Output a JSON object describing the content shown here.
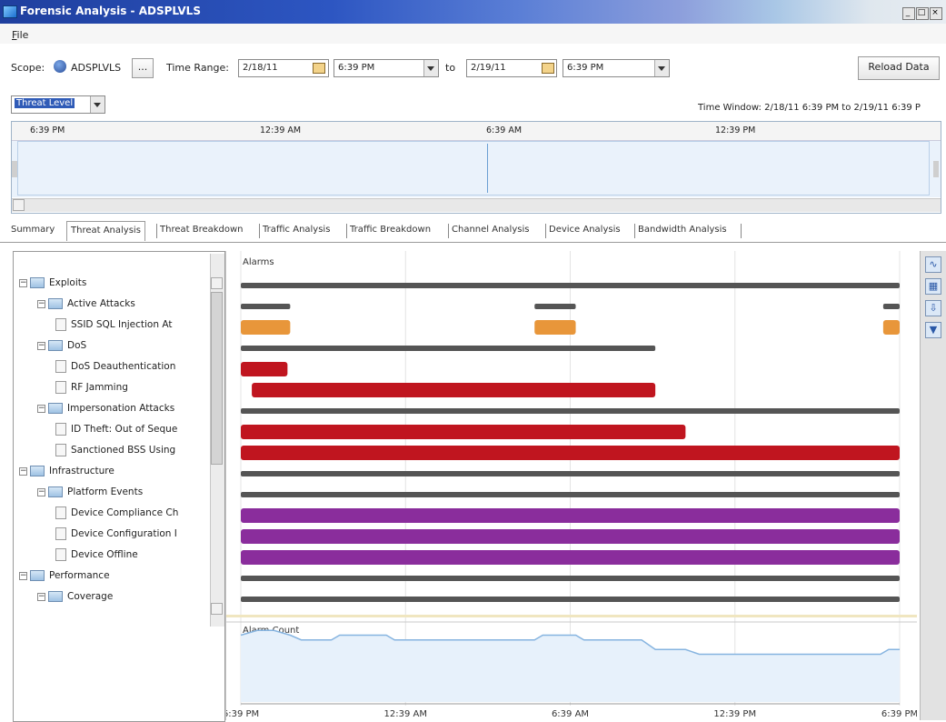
{
  "window": {
    "title": "Forensic Analysis - ADSPLVLS"
  },
  "menu": {
    "file_label": "File"
  },
  "toolbar": {
    "scope_label": "Scope:",
    "scope_value": "ADSPLVLS",
    "browse_label": "...",
    "time_range_label": "Time Range:",
    "start_date": "2/18/11",
    "start_time": "6:39 PM",
    "to_label": "to",
    "end_date": "2/19/11",
    "end_time": "6:39 PM",
    "reload_label": "Reload Data"
  },
  "metric_selector": {
    "value": "Threat Level"
  },
  "time_window": "Time Window: 2/18/11 6:39 PM to 2/19/11 6:39 P",
  "overview_axis": [
    "6:39 PM",
    "12:39 AM",
    "6:39 AM",
    "12:39 PM"
  ],
  "tabs": [
    "Summary",
    "Threat Analysis",
    "Threat Breakdown",
    "Traffic Analysis",
    "Traffic Breakdown",
    "Channel Analysis",
    "Device Analysis",
    "Bandwidth Analysis"
  ],
  "active_tab": "Threat Analysis",
  "tree": [
    {
      "label": "Exploits",
      "level": 0,
      "kind": "folder"
    },
    {
      "label": "Active Attacks",
      "level": 1,
      "kind": "folder"
    },
    {
      "label": "SSID SQL Injection At",
      "level": 2,
      "kind": "doc"
    },
    {
      "label": "DoS",
      "level": 1,
      "kind": "folder"
    },
    {
      "label": "DoS Deauthentication",
      "level": 2,
      "kind": "doc"
    },
    {
      "label": "RF Jamming",
      "level": 2,
      "kind": "doc"
    },
    {
      "label": "Impersonation Attacks",
      "level": 1,
      "kind": "folder"
    },
    {
      "label": "ID Theft: Out of Seque",
      "level": 2,
      "kind": "doc"
    },
    {
      "label": "Sanctioned BSS Using",
      "level": 2,
      "kind": "doc"
    },
    {
      "label": "Infrastructure",
      "level": 0,
      "kind": "folder"
    },
    {
      "label": "Platform Events",
      "level": 1,
      "kind": "folder"
    },
    {
      "label": "Device Compliance Ch",
      "level": 2,
      "kind": "doc"
    },
    {
      "label": "Device Configuration I",
      "level": 2,
      "kind": "doc"
    },
    {
      "label": "Device Offline",
      "level": 2,
      "kind": "doc"
    },
    {
      "label": "Performance",
      "level": 0,
      "kind": "folder"
    },
    {
      "label": "Coverage",
      "level": 1,
      "kind": "folder"
    }
  ],
  "chart_data": [
    {
      "type": "timeline",
      "title": "Alarms",
      "x_ticks": [
        "6:39 PM",
        "12:39 AM",
        "6:39 AM",
        "12:39 PM",
        "6:39 PM"
      ],
      "x_range_hours": [
        0,
        24
      ],
      "colors": {
        "summary": "#555555",
        "major": "#e8963a",
        "critical": "#c0151f",
        "info": "#8a2d9c"
      },
      "rows": [
        {
          "level": "summary",
          "segments": [
            [
              0,
              24
            ]
          ]
        },
        {
          "level": "summary",
          "segments": [
            [
              0,
              1.8
            ],
            [
              10.7,
              12.2
            ],
            [
              23.4,
              24
            ]
          ]
        },
        {
          "level": "major",
          "segments": [
            [
              0,
              1.8
            ],
            [
              10.7,
              12.2
            ],
            [
              23.4,
              24
            ]
          ]
        },
        {
          "level": "summary",
          "segments": [
            [
              0,
              15.1
            ]
          ]
        },
        {
          "level": "critical",
          "segments": [
            [
              0,
              1.7
            ]
          ]
        },
        {
          "level": "critical",
          "segments": [
            [
              0.4,
              15.1
            ]
          ]
        },
        {
          "level": "summary",
          "segments": [
            [
              0,
              24
            ]
          ]
        },
        {
          "level": "critical",
          "segments": [
            [
              0,
              16.2
            ]
          ]
        },
        {
          "level": "critical",
          "segments": [
            [
              0,
              24
            ]
          ]
        },
        {
          "level": "summary",
          "segments": [
            [
              0,
              24
            ]
          ]
        },
        {
          "level": "summary",
          "segments": [
            [
              0,
              24
            ]
          ]
        },
        {
          "level": "info",
          "segments": [
            [
              0,
              24
            ]
          ]
        },
        {
          "level": "info",
          "segments": [
            [
              0,
              24
            ]
          ]
        },
        {
          "level": "info",
          "segments": [
            [
              0,
              24
            ]
          ]
        },
        {
          "level": "summary",
          "segments": [
            [
              0,
              24
            ]
          ]
        },
        {
          "level": "summary",
          "segments": [
            [
              0,
              24
            ]
          ]
        }
      ]
    },
    {
      "type": "area",
      "title": "Alarm Count",
      "x_ticks": [
        "6:39 PM",
        "12:39 AM",
        "6:39 AM",
        "12:39 PM",
        "6:39 PM"
      ],
      "x_hours": [
        0,
        0.6,
        1.2,
        1.8,
        2.2,
        3.3,
        3.6,
        5.3,
        5.6,
        10.7,
        11,
        12.2,
        12.5,
        14.6,
        15.1,
        16.2,
        16.7,
        23.3,
        23.6,
        24
      ],
      "y": [
        14,
        15,
        15,
        14,
        13,
        13,
        14,
        14,
        13,
        13,
        14,
        14,
        13,
        13,
        11,
        11,
        10,
        10,
        11,
        11
      ],
      "ylim": [
        0,
        16
      ]
    }
  ]
}
